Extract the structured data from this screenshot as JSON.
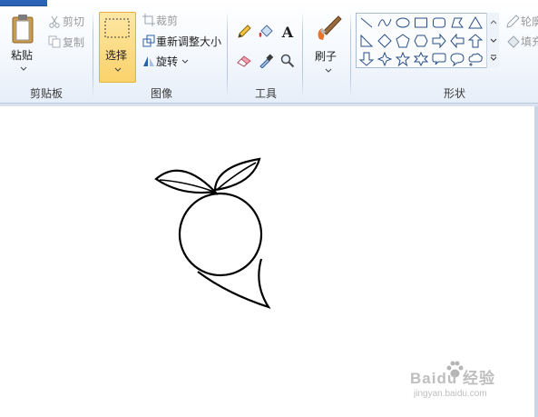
{
  "clipboard": {
    "paste_label": "粘贴",
    "cut_label": "剪切",
    "copy_label": "复制",
    "group_label": "剪贴板"
  },
  "image": {
    "select_label": "选择",
    "crop_label": "裁剪",
    "resize_label": "重新调整大小",
    "rotate_label": "旋转",
    "group_label": "图像"
  },
  "tools": {
    "group_label": "工具",
    "text_tool_glyph": "A",
    "items": [
      "pencil-icon",
      "fill-bucket-icon",
      "text-icon",
      "eraser-icon",
      "color-picker-icon",
      "magnifier-icon"
    ]
  },
  "brushes": {
    "label": "刷子"
  },
  "shapes": {
    "group_label": "形状",
    "outline_label": "轮廓",
    "fill_label": "填充",
    "items": [
      "line-shape",
      "curve-shape",
      "oval-shape",
      "rectangle-shape",
      "rounded-rectangle-shape",
      "polygon-shape",
      "triangle-shape",
      "right-triangle-shape",
      "diamond-shape",
      "pentagon-shape",
      "hexagon-shape",
      "right-arrow-shape",
      "left-arrow-shape",
      "up-arrow-shape",
      "down-arrow-shape",
      "four-point-star-shape",
      "five-point-star-shape",
      "six-point-star-shape",
      "rounded-callout-shape",
      "oval-callout-shape",
      "cloud-callout-shape"
    ]
  },
  "watermark": {
    "brand": "Baidu 经验",
    "url": "jingyan.baidu.com"
  },
  "colors": {
    "select_active_bg": "#fbd26b",
    "ribbon_bg": "#f4f8fd",
    "file_tab": "#2b63b6",
    "brush_orange": "#e8722a",
    "canvas": "#ffffff"
  }
}
